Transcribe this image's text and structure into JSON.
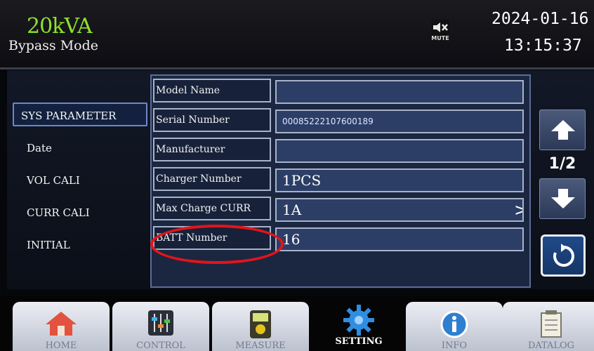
{
  "header": {
    "capacity": "20kVA",
    "mode": "Bypass Mode",
    "mute_label": "MUTE",
    "date": "2024-01-16",
    "time": "13:15:37"
  },
  "menu": {
    "items": [
      {
        "label": "SYS PARAMETER",
        "active": true
      },
      {
        "label": "Date",
        "active": false
      },
      {
        "label": "VOL CALI",
        "active": false
      },
      {
        "label": "CURR CALI",
        "active": false
      },
      {
        "label": "INITIAL",
        "active": false
      }
    ]
  },
  "params": {
    "rows": [
      {
        "label": "Model Name",
        "value": ""
      },
      {
        "label": "Serial Number",
        "value": "00085222107600189"
      },
      {
        "label": "Manufacturer",
        "value": ""
      },
      {
        "label": "Charger Number",
        "value": "1PCS"
      },
      {
        "label": "Max Charge CURR",
        "value": "1A",
        "chevron": ">"
      },
      {
        "label": "BATT Number",
        "value": "16"
      }
    ]
  },
  "pager": {
    "indicator": "1/2"
  },
  "nav": {
    "tabs": [
      {
        "label": "HOME",
        "icon": "house-icon",
        "active": false
      },
      {
        "label": "CONTROL",
        "icon": "sliders-icon",
        "active": false
      },
      {
        "label": "MEASURE",
        "icon": "multimeter-icon",
        "active": false
      },
      {
        "label": "SETTING",
        "icon": "gear-icon",
        "active": true
      },
      {
        "label": "INFO",
        "icon": "info-icon",
        "active": false
      },
      {
        "label": "DATALOG",
        "icon": "datalog-icon",
        "active": false
      }
    ]
  },
  "colors": {
    "capacity": "#8fe22a",
    "panel": "#1b2741",
    "value_field": "#2c3e66",
    "highlight_circle": "#e3141a",
    "nav_tab": "#dfe2ea"
  }
}
